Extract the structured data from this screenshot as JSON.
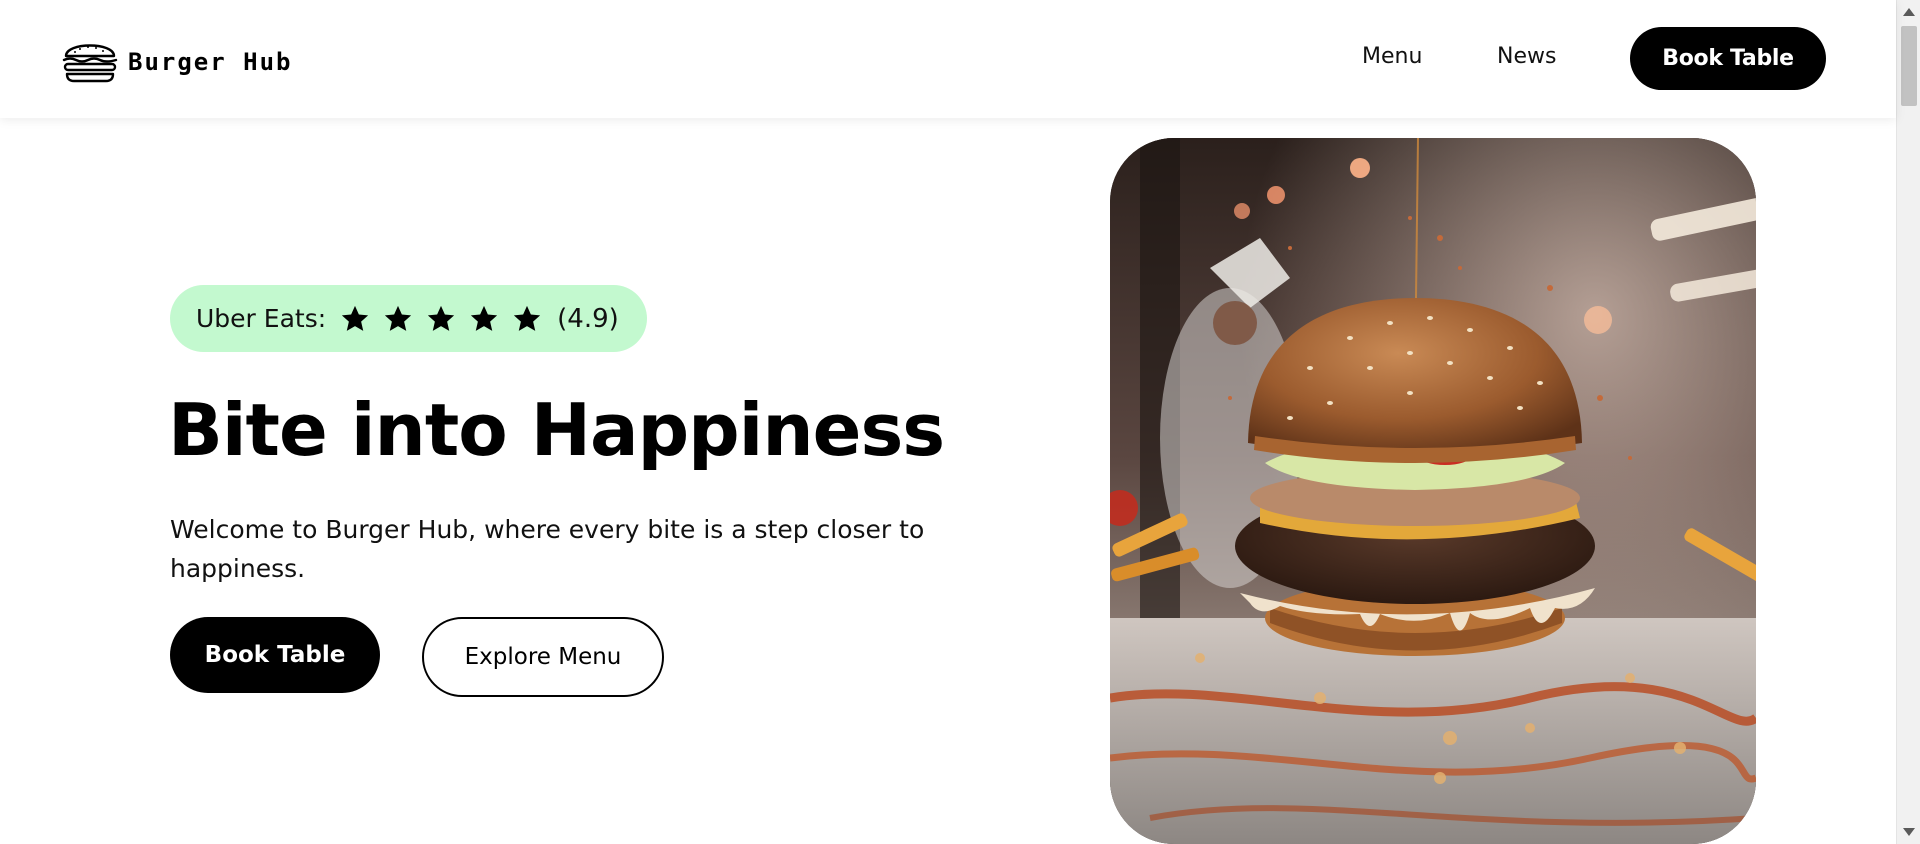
{
  "brand": {
    "name": "Burger Hub",
    "logo_icon": "burger-icon"
  },
  "nav": {
    "items": [
      {
        "label": "Menu"
      },
      {
        "label": "News"
      }
    ],
    "cta_label": "Book Table"
  },
  "hero": {
    "rating": {
      "label": "Uber Eats:",
      "stars": 5,
      "star_icon": "star-icon",
      "score": "(4.9)",
      "badge_color": "#c3f9cf"
    },
    "title": "Bite into Happiness",
    "description": "Welcome to Burger Hub, where every bite is a step closer to happiness.",
    "primary_button": "Book Table",
    "secondary_button": "Explore Menu",
    "image_icon": "burger-photo"
  },
  "colors": {
    "primary": "#000000",
    "background": "#ffffff",
    "badge": "#c3f9cf"
  }
}
